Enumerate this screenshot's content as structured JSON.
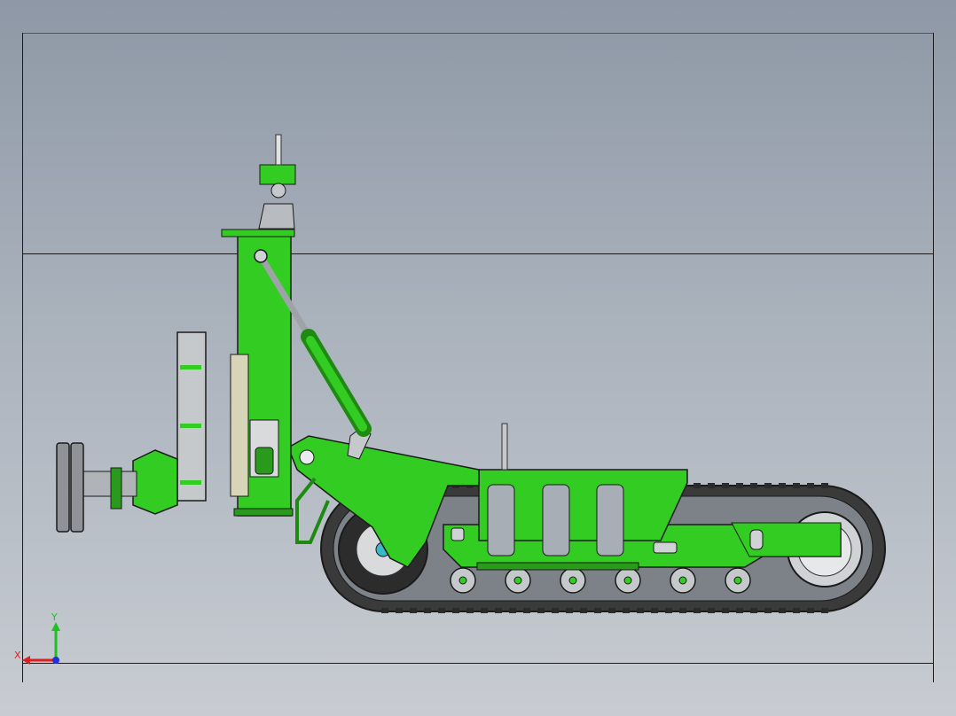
{
  "viewport": {
    "background_top": "#8e98a6",
    "background_bottom": "#c8ccd2"
  },
  "model": {
    "colors": {
      "body_green": "#33cc22",
      "dark_green": "#1f8a12",
      "track_dark": "#3a3a3a",
      "track_gray": "#6c6c6c",
      "steel": "#b8bcc0",
      "outline": "#1a1a1a"
    }
  },
  "triad": {
    "x_label": "X",
    "y_label": "Y",
    "x_color": "#e02020",
    "y_color": "#20c020",
    "z_color": "#2030e0"
  }
}
